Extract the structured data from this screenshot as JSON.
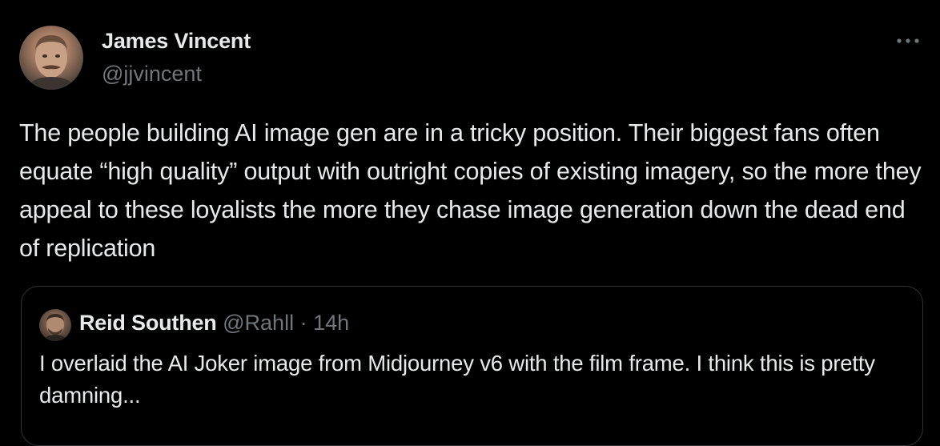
{
  "author": {
    "name": "James Vincent",
    "handle": "@jjvincent"
  },
  "tweet": {
    "text": "The people building AI image gen are in a tricky position. Their biggest fans often equate “high quality” output with outright copies of existing imagery, so the more they appeal to these loyalists the more they chase image generation down the dead end of replication"
  },
  "more_icon": "more-horizontal-icon",
  "quoted": {
    "name": "Reid Southen",
    "handle": "@Rahll",
    "separator": "·",
    "time": "14h",
    "text": "I overlaid the AI Joker image from Midjourney v6 with the film frame. I think this is pretty damning..."
  },
  "colors": {
    "background": "#000000",
    "primary_text": "#e7e9ea",
    "secondary_text": "#71767b",
    "border": "#2f3336"
  }
}
